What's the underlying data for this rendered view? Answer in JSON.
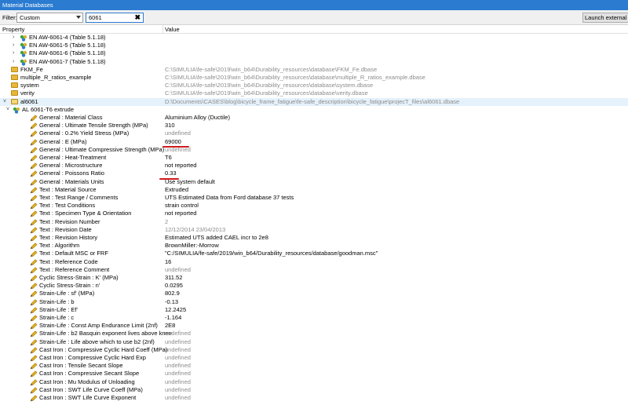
{
  "window": {
    "title": "Material Databases"
  },
  "filter": {
    "label": "Filter:",
    "mode": "Custom",
    "text": "6061",
    "clear_glyph": "✖"
  },
  "launch_button": {
    "label": "Launch external dat"
  },
  "columns": {
    "property": "Property",
    "value": "Value"
  },
  "tree": [
    {
      "name": "EN AW-6061-4 (Table 5.1.18)",
      "value": "",
      "kind": "material",
      "expander": "›",
      "indent": 1
    },
    {
      "name": "EN AW-6061-5 (Table 5.1.18)",
      "value": "",
      "kind": "material",
      "expander": "›",
      "indent": 1
    },
    {
      "name": "EN AW-6061-6 (Table 5.1.18)",
      "value": "",
      "kind": "material",
      "expander": "›",
      "indent": 1
    },
    {
      "name": "EN AW-6061-7 (Table 5.1.18)",
      "value": "",
      "kind": "material",
      "expander": "›",
      "indent": 1
    },
    {
      "name": "FKM_Fe",
      "value": "C:\\SIMULIA\\fe-safe\\2019\\win_b64\\Durability_resources\\database\\FKM_Fe.dbase",
      "kind": "folder",
      "grey": true,
      "indent": 0
    },
    {
      "name": "multiple_R_ratios_example",
      "value": "C:\\SIMULIA\\fe-safe\\2019\\win_b64\\Durability_resources\\database\\multiple_R_ratios_example.dbase",
      "kind": "folder",
      "grey": true,
      "indent": 0
    },
    {
      "name": "system",
      "value": "C:\\SIMULIA\\fe-safe\\2019\\win_b64\\Durability_resources\\database\\system.dbase",
      "kind": "folder",
      "grey": true,
      "indent": 0
    },
    {
      "name": "verity",
      "value": "C:\\SIMULIA\\fe-safe\\2019\\win_b64\\Durability_resources\\database\\verity.dbase",
      "kind": "folder",
      "grey": true,
      "indent": 0
    },
    {
      "name": "al6061",
      "value": "D:\\Documents\\CASES\\blog\\bicycle_frame_fatigue\\fe-safe_description\\bicycle_fatigue\\projecT_files\\al6061.dbase",
      "kind": "folder-open",
      "grey": true,
      "expander": "˅",
      "indent": 0,
      "selected": true
    },
    {
      "name": "AL 6061-T6 extrude",
      "value": "",
      "kind": "material",
      "expander": "˅",
      "indent": 1
    },
    {
      "name": "General : Material Class",
      "value": "Aluminium Alloy (Ductile)",
      "kind": "prop"
    },
    {
      "name": "General : Ultimate Tensile Strength (MPa)",
      "value": "310",
      "kind": "prop"
    },
    {
      "name": "General : 0.2% Yield Stress (MPa)",
      "value": "undefined",
      "kind": "prop",
      "grey": true
    },
    {
      "name": "General : E (MPa)",
      "value": "69000",
      "kind": "prop"
    },
    {
      "name": "General : Ultimate Compressive Strength (MPa)",
      "value": "undefined",
      "kind": "prop",
      "grey": true
    },
    {
      "name": "General : Heat-Treatment",
      "value": "T6",
      "kind": "prop"
    },
    {
      "name": "General : Microstructure",
      "value": "not reported",
      "kind": "prop"
    },
    {
      "name": "General : Poissons Ratio",
      "value": "0.33",
      "kind": "prop"
    },
    {
      "name": "General : Materials Units",
      "value": "Use system default",
      "kind": "prop"
    },
    {
      "name": "Text : Material Source",
      "value": "Extruded",
      "kind": "prop"
    },
    {
      "name": "Text : Test Range / Comments",
      "value": "UTS Estimated Data from Ford database 37 tests",
      "kind": "prop"
    },
    {
      "name": "Text : Test Conditions",
      "value": "strain control",
      "kind": "prop"
    },
    {
      "name": "Text : Specimen Type & Orientation",
      "value": "not reported",
      "kind": "prop"
    },
    {
      "name": "Text : Revision Number",
      "value": "2",
      "kind": "prop",
      "grey": true
    },
    {
      "name": "Text : Revision Date",
      "value": "12/12/2014 23/04/2013",
      "kind": "prop",
      "grey": true
    },
    {
      "name": "Text : Revision History",
      "value": "Estimated UTS added CAEL incr to 2e8",
      "kind": "prop"
    },
    {
      "name": "Text : Algorithm",
      "value": "BrownMiller:-Morrow",
      "kind": "prop"
    },
    {
      "name": "Text : Default MSC or FRF",
      "value": "\"C:/SIMULIA/fe-safe/2019/win_b64/Durability_resources/database/goodman.msc\"",
      "kind": "prop"
    },
    {
      "name": "Text : Reference Code",
      "value": "16",
      "kind": "prop"
    },
    {
      "name": "Text : Reference Comment",
      "value": "undefined",
      "kind": "prop",
      "grey": true
    },
    {
      "name": "Cyclic Stress-Strain : K' (MPa)",
      "value": "311.52",
      "kind": "prop"
    },
    {
      "name": "Cyclic Stress-Strain : n'",
      "value": "0.0295",
      "kind": "prop"
    },
    {
      "name": "Strain-Life : sf' (MPa)",
      "value": "802.9",
      "kind": "prop"
    },
    {
      "name": "Strain-Life : b",
      "value": "-0.13",
      "kind": "prop"
    },
    {
      "name": "Strain-Life : Ef'",
      "value": "12.2425",
      "kind": "prop"
    },
    {
      "name": "Strain-Life : c",
      "value": "-1.164",
      "kind": "prop"
    },
    {
      "name": "Strain-Life : Const Amp Endurance Limit (2nf)",
      "value": "2E8",
      "kind": "prop"
    },
    {
      "name": "Strain-Life : b2 Basquin exponent lives above knee",
      "value": "undefined",
      "kind": "prop",
      "grey": true
    },
    {
      "name": "Strain-Life : Life above which to use b2 (2nf)",
      "value": "undefined",
      "kind": "prop",
      "grey": true
    },
    {
      "name": "Cast Iron : Compressive Cyclic Hard Coeff (MPa)",
      "value": "undefined",
      "kind": "prop",
      "grey": true
    },
    {
      "name": "Cast Iron : Compressive Cyclic Hard Exp",
      "value": "undefined",
      "kind": "prop",
      "grey": true
    },
    {
      "name": "Cast Iron : Tensile Secant Slope",
      "value": "undefined",
      "kind": "prop",
      "grey": true
    },
    {
      "name": "Cast Iron : Compressive Secant Slope",
      "value": "undefined",
      "kind": "prop",
      "grey": true
    },
    {
      "name": "Cast Iron : Mu Modulus of Unloading",
      "value": "undefined",
      "kind": "prop",
      "grey": true
    },
    {
      "name": "Cast Iron : SWT Life Curve Coeff (MPa)",
      "value": "undefined",
      "kind": "prop",
      "grey": true
    },
    {
      "name": "Cast Iron : SWT Life Curve Exponent",
      "value": "undefined",
      "kind": "prop",
      "grey": true
    }
  ],
  "annotations": {
    "underline_color": "#d11a1a"
  }
}
